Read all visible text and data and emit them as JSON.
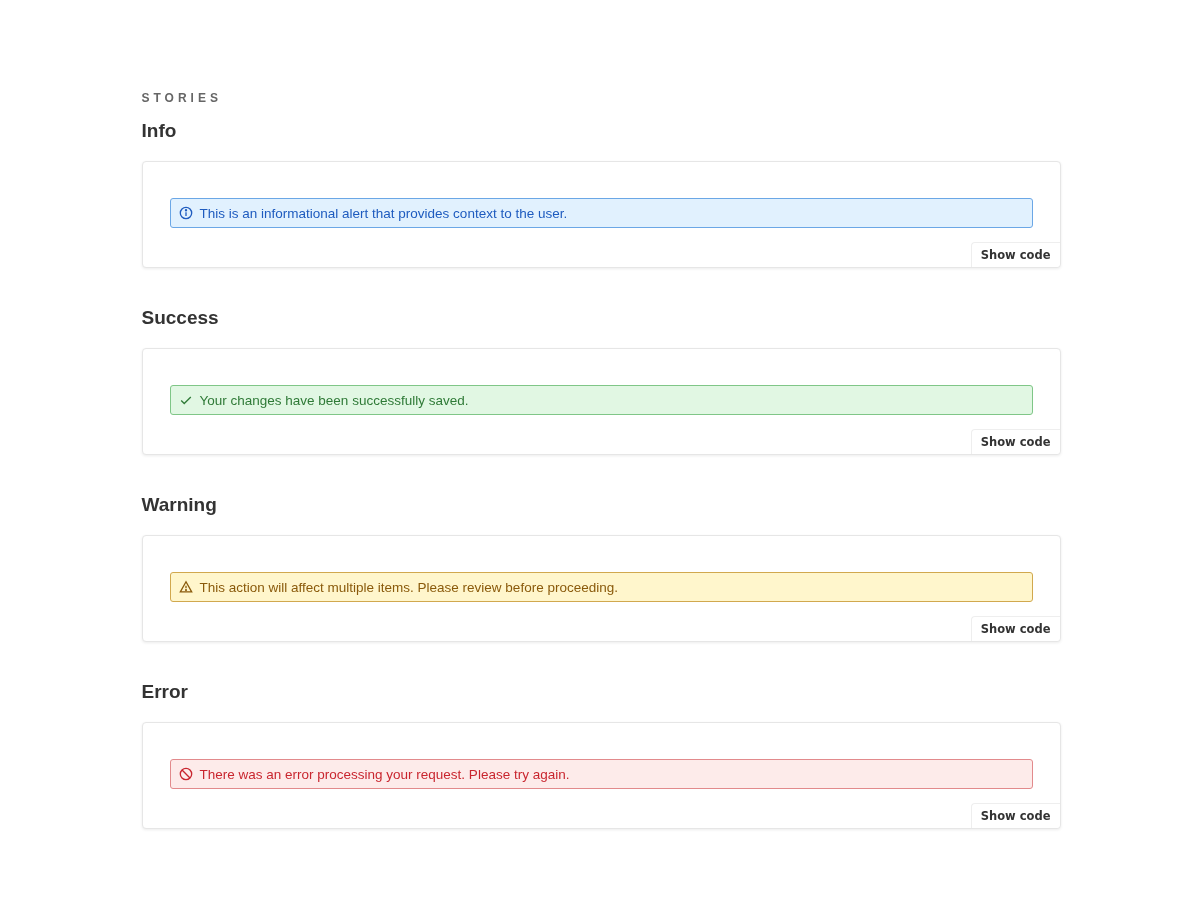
{
  "eyebrow": "STORIES",
  "stories": [
    {
      "title": "Info",
      "alert": {
        "kind": "info",
        "message": "This is an informational alert that provides context to the user."
      },
      "button": "Show code"
    },
    {
      "title": "Success",
      "alert": {
        "kind": "success",
        "message": "Your changes have been successfully saved."
      },
      "button": "Show code"
    },
    {
      "title": "Warning",
      "alert": {
        "kind": "warning",
        "message": "This action will affect multiple items. Please review before proceeding."
      },
      "button": "Show code"
    },
    {
      "title": "Error",
      "alert": {
        "kind": "error",
        "message": "There was an error processing your request. Please try again."
      },
      "button": "Show code"
    }
  ]
}
